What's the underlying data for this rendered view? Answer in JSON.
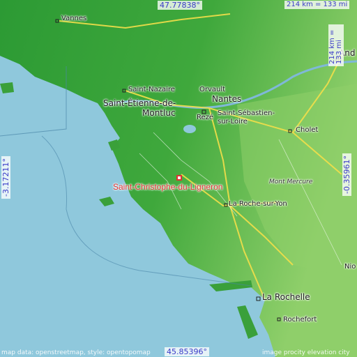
{
  "map": {
    "top_coord": "47.77838°",
    "bottom_coord": "45.85396°",
    "left_coord": "-3.17211°",
    "right_coord": "-0.35961°",
    "scale_top": "214 km = 133 mi",
    "scale_right": "214 km = 133 mi",
    "highlight_label": "Saint-Christophe-du-Ligneron",
    "attribution": "map data: openstreetmap, style: opentopomap",
    "source": "image procity elevation city",
    "colors": {
      "water": "#8fc8dc",
      "land_low": "#2f9d35",
      "land_mid": "#6fbf4f",
      "highlight": "#e03232"
    }
  },
  "places": {
    "vannes": "Vannes",
    "saint_nazaire": "Saint-Nazaire",
    "saint_etienne": "Saint-Étienne-de-",
    "montluc": "Montluc",
    "orvault": "Orvault",
    "nantes": "Nantes",
    "reze": "Rezé",
    "saint_sebastien": "Saint-Sébastien-",
    "sur_loire": "sur-Loire",
    "cholet": "Cholet",
    "mont_mercure": "Mont Mercure",
    "la_roche": "La Roche-sur-Yon",
    "la_rochelle": "La Rochelle",
    "rochefort": "Rochefort",
    "angers": "And",
    "niort": "Nio"
  }
}
